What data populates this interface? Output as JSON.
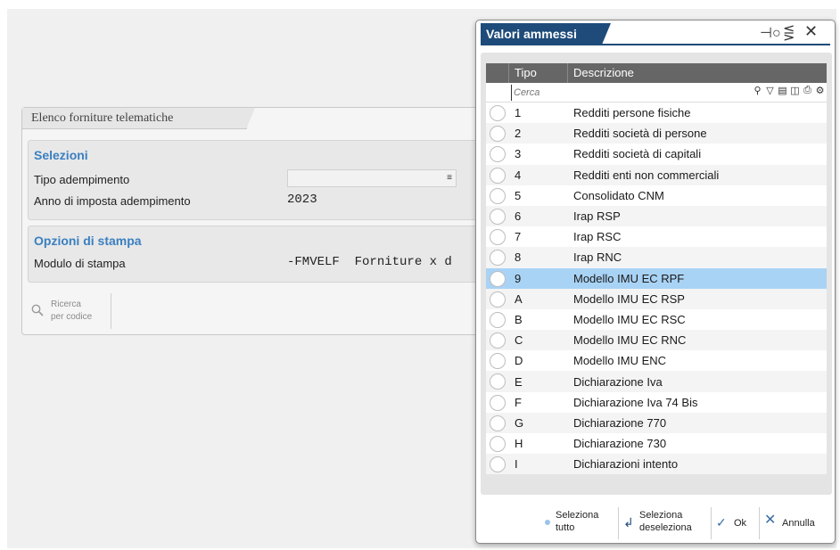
{
  "main": {
    "title": "Elenco forniture telematiche",
    "selezioni": {
      "title": "Selezioni",
      "tipo_label": "Tipo adempimento",
      "tipo_value": "",
      "anno_label": "Anno di imposta adempimento",
      "anno_value": "2023"
    },
    "opzioni": {
      "title": "Opzioni di stampa",
      "modulo_label": "Modulo di stampa",
      "modulo_value": "-FMVELF  Forniture x d"
    },
    "search_button": {
      "line1": "Ricerca",
      "line2": "per codice"
    }
  },
  "popup": {
    "title": "Valori ammessi",
    "columns": {
      "tipo": "Tipo",
      "descrizione": "Descrizione"
    },
    "filter_placeholder": "Cerca",
    "rows": [
      {
        "tipo": "1",
        "desc": "Redditi persone fisiche"
      },
      {
        "tipo": "2",
        "desc": "Redditi società di persone"
      },
      {
        "tipo": "3",
        "desc": "Redditi società di capitali"
      },
      {
        "tipo": "4",
        "desc": "Redditi enti non commerciali"
      },
      {
        "tipo": "5",
        "desc": "Consolidato CNM"
      },
      {
        "tipo": "6",
        "desc": "Irap RSP"
      },
      {
        "tipo": "7",
        "desc": "Irap RSC"
      },
      {
        "tipo": "8",
        "desc": "Irap RNC"
      },
      {
        "tipo": "9",
        "desc": "Modello IMU EC RPF"
      },
      {
        "tipo": "A",
        "desc": "Modello IMU EC RSP"
      },
      {
        "tipo": "B",
        "desc": "Modello IMU EC RSC"
      },
      {
        "tipo": "C",
        "desc": "Modello IMU EC RNC"
      },
      {
        "tipo": "D",
        "desc": "Modello IMU ENC"
      },
      {
        "tipo": "E",
        "desc": "Dichiarazione Iva"
      },
      {
        "tipo": "F",
        "desc": "Dichiarazione Iva 74 Bis"
      },
      {
        "tipo": "G",
        "desc": "Dichiarazione 770"
      },
      {
        "tipo": "H",
        "desc": "Dichiarazione 730"
      },
      {
        "tipo": "I",
        "desc": "Dichiarazioni intento"
      }
    ],
    "selected_tipo": "9",
    "footer": {
      "seleziona_tutto_1": "Seleziona",
      "seleziona_tutto_2": "tutto",
      "seleziona_desel_1": "Seleziona",
      "seleziona_desel_2": "deseleziona",
      "ok": "Ok",
      "annulla": "Annulla"
    }
  },
  "colors": {
    "accent_blue": "#3a7fc1",
    "title_bar": "#1e4b7a",
    "selected_row": "#a9d3f5",
    "grid_header": "#666666"
  }
}
